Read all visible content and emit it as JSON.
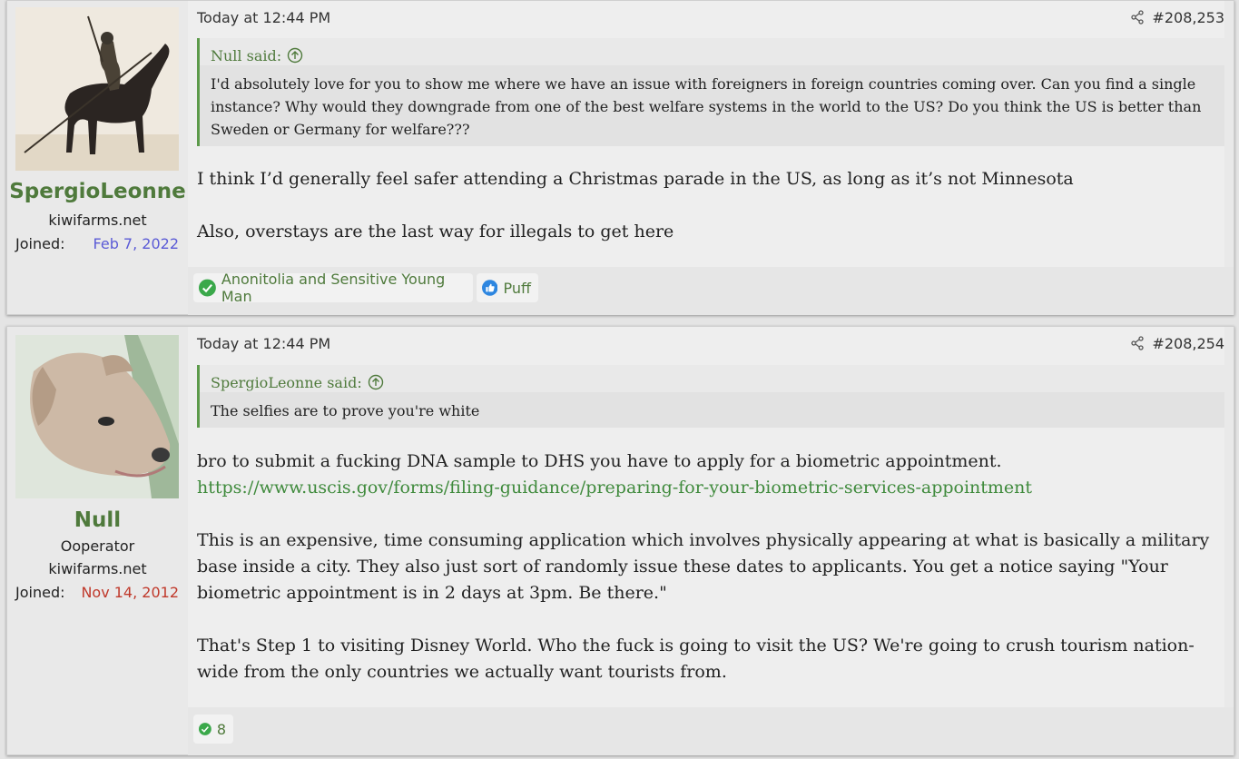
{
  "posts": [
    {
      "username": "SpergioLeonne",
      "user_site": "kiwifarms.net",
      "joined_label": "Joined:",
      "joined_date": "Feb 7, 2022",
      "joined_color": "#5b5bd6",
      "date": "Today at 12:44 PM",
      "post_number": "#208,253",
      "quote": {
        "author": "Null said:",
        "text": "I'd absolutely love for you to show me where we have an issue with foreigners in foreign countries coming over. Can you find a single instance? Why would they downgrade from one of the best welfare systems in the world to the US? Do you think the US is better than Sweden or Germany for welfare???"
      },
      "body": [
        "I think I’d generally feel safer attending a Christmas parade in the US, as long as it’s not Minnesota",
        "Also, overstays are the last way for illegals to get here"
      ],
      "reactions": [
        {
          "icon": "check-icon",
          "label": "Anonitolia and Sensitive Young Man"
        },
        {
          "icon": "thumbs-up-icon",
          "label": "Puff"
        }
      ]
    },
    {
      "username": "Null",
      "user_title": "Ooperator",
      "user_site": "kiwifarms.net",
      "joined_label": "Joined:",
      "joined_date": "Nov 14, 2012",
      "joined_color": "#c0392b",
      "date": "Today at 12:44 PM",
      "post_number": "#208,254",
      "quote": {
        "author": "SpergioLeonne said:",
        "text": "The selfies are to prove you're white"
      },
      "body": [
        "bro to submit a fucking DNA sample to DHS you have to apply for a biometric appointment.",
        "https://www.uscis.gov/forms/filing-guidance/preparing-for-your-biometric-services-appointment",
        "This is an expensive, time consuming application which involves physically appearing at what is basically a military base inside a city. They also just sort of randomly issue these dates to applicants. You get a notice saying \"Your biometric appointment is in 2 days at 3pm. Be there.\"",
        "That's Step 1 to visiting Disney World. Who the fuck is going to visit the US? We're going to crush tourism nation-wide from the only countries we actually want tourists from."
      ],
      "reactions": [
        {
          "icon": "check-icon",
          "label": "8"
        }
      ]
    }
  ],
  "colors": {
    "accent_green": "#4f7a3c",
    "link_green": "#3f8a3c"
  }
}
